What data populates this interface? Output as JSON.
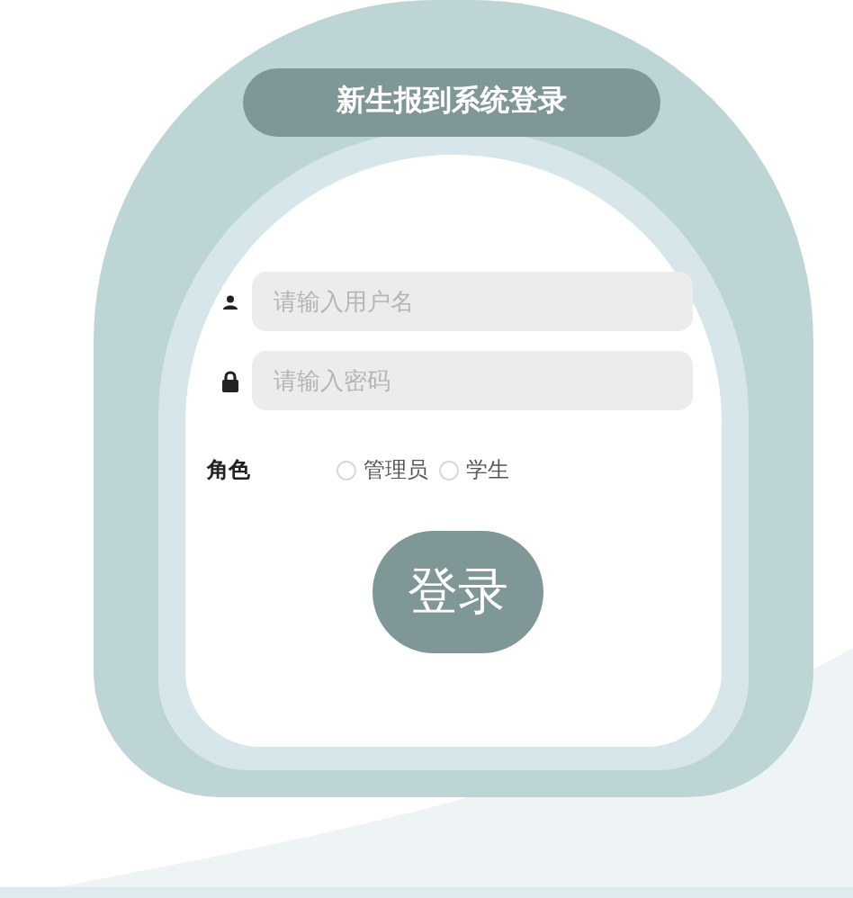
{
  "title": "新生报到系统登录",
  "fields": [
    {
      "kind": "user",
      "placeholder": "请输入用户名"
    },
    {
      "kind": "lock",
      "placeholder": "请输入密码"
    }
  ],
  "role": {
    "label": "角色",
    "options": [
      {
        "label": "管理员",
        "selected": false
      },
      {
        "label": "学生",
        "selected": false
      }
    ]
  },
  "login_button": "登录"
}
